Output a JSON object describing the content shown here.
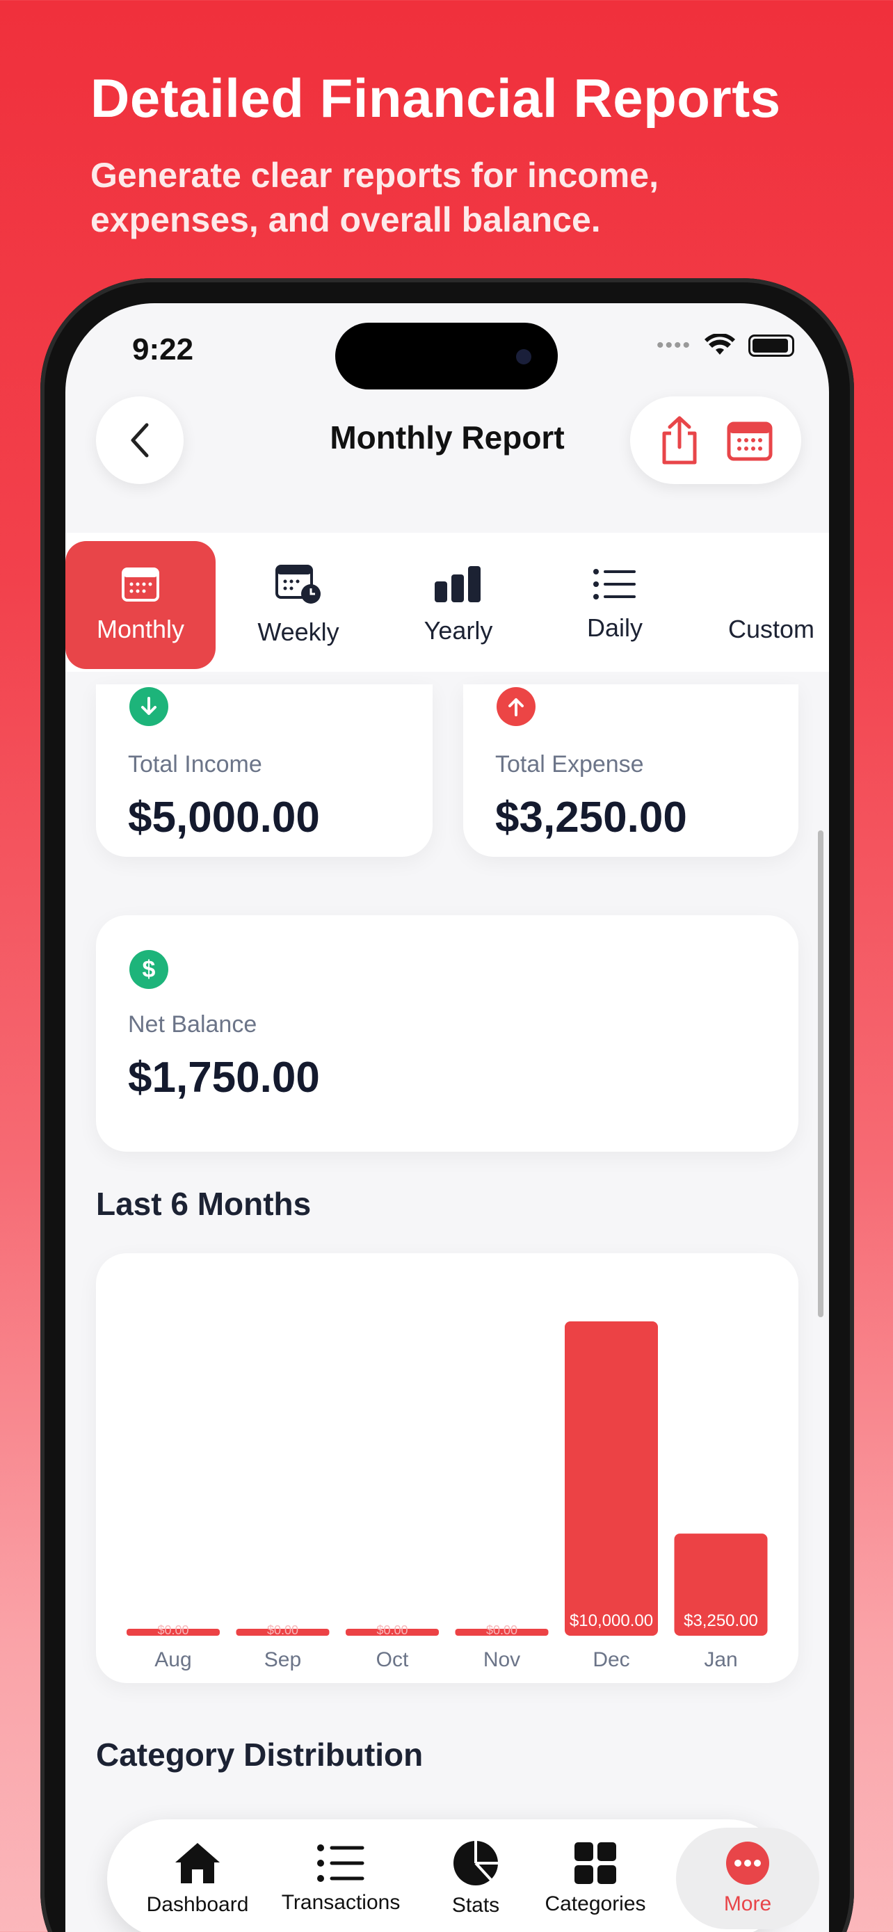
{
  "promo": {
    "title": "Detailed Financial Reports",
    "subtitle": "Generate clear reports for income, expenses, and overall balance."
  },
  "status_bar": {
    "time": "9:22",
    "dots": "••••"
  },
  "header": {
    "title": "Monthly Report"
  },
  "tabs": [
    {
      "label": "Monthly",
      "icon": "calendar-icon",
      "active": true
    },
    {
      "label": "Weekly",
      "icon": "calendar-clock-icon",
      "active": false
    },
    {
      "label": "Yearly",
      "icon": "bar-chart-icon",
      "active": false
    },
    {
      "label": "Daily",
      "icon": "list-icon",
      "active": false
    },
    {
      "label": "Custom",
      "icon": "custom-icon",
      "active": false
    }
  ],
  "summary": {
    "income": {
      "label": "Total Income",
      "value": "$5,000.00",
      "icon": "arrow-down-icon",
      "color": "#1db47a"
    },
    "expense": {
      "label": "Total Expense",
      "value": "$3,250.00",
      "icon": "arrow-up-icon",
      "color": "#ec4545"
    },
    "balance": {
      "label": "Net Balance",
      "value": "$1,750.00",
      "icon": "dollar-icon",
      "color": "#1db47a"
    }
  },
  "sections": {
    "last_months": "Last 6 Months",
    "category": "Category Distribution"
  },
  "chart_data": {
    "type": "bar",
    "categories": [
      "Aug",
      "Sep",
      "Oct",
      "Nov",
      "Dec",
      "Jan"
    ],
    "values": [
      0,
      0,
      0,
      0,
      10000,
      3250
    ],
    "data_labels": [
      "$0.00",
      "$0.00",
      "$0.00",
      "$0.00",
      "$10,000.00",
      "$3,250.00"
    ],
    "color": "#ec4245",
    "ylim": [
      0,
      10000
    ],
    "grid": false
  },
  "nav": [
    {
      "label": "Dashboard",
      "icon": "home-icon",
      "active": false
    },
    {
      "label": "Transactions",
      "icon": "list-icon",
      "active": false
    },
    {
      "label": "Stats",
      "icon": "pie-chart-icon",
      "active": false
    },
    {
      "label": "Categories",
      "icon": "grid-icon",
      "active": false
    },
    {
      "label": "More",
      "icon": "more-icon",
      "active": true
    }
  ],
  "colors": {
    "accent": "#e84549",
    "income": "#1db47a",
    "expense": "#ec4545"
  }
}
